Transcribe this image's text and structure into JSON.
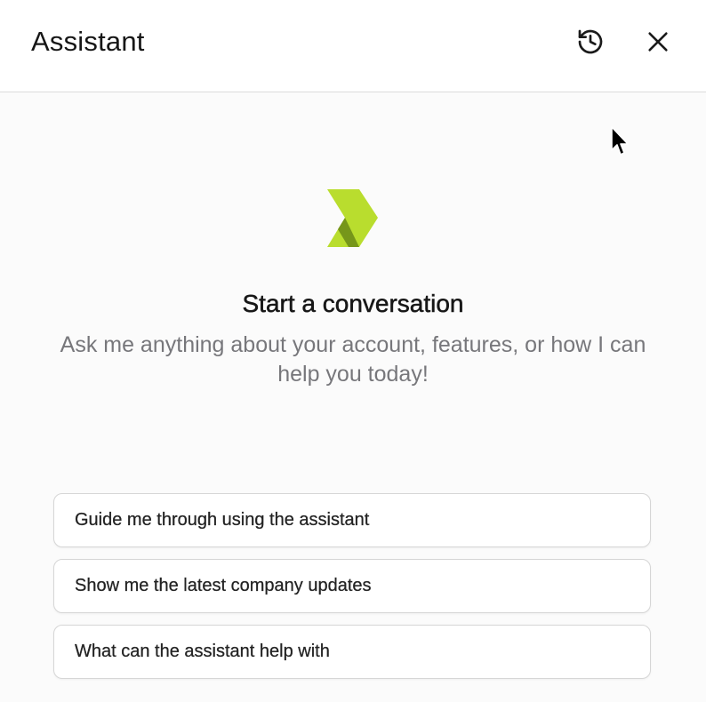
{
  "header": {
    "title": "Assistant",
    "history_icon": "history-icon",
    "close_icon": "close-icon"
  },
  "empty_state": {
    "logo_icon": "assistant-logo-chevron",
    "heading": "Start a conversation",
    "subtext": "Ask me anything about your account, features, or how I can help you today!"
  },
  "suggestions": [
    "Guide me through using the assistant",
    "Show me the latest company updates",
    "What can the assistant help with"
  ],
  "colors": {
    "logo_light": "#b9dd2e",
    "logo_dark": "#5e7a12",
    "muted_text": "#77777b",
    "border": "#d6d6d6"
  }
}
